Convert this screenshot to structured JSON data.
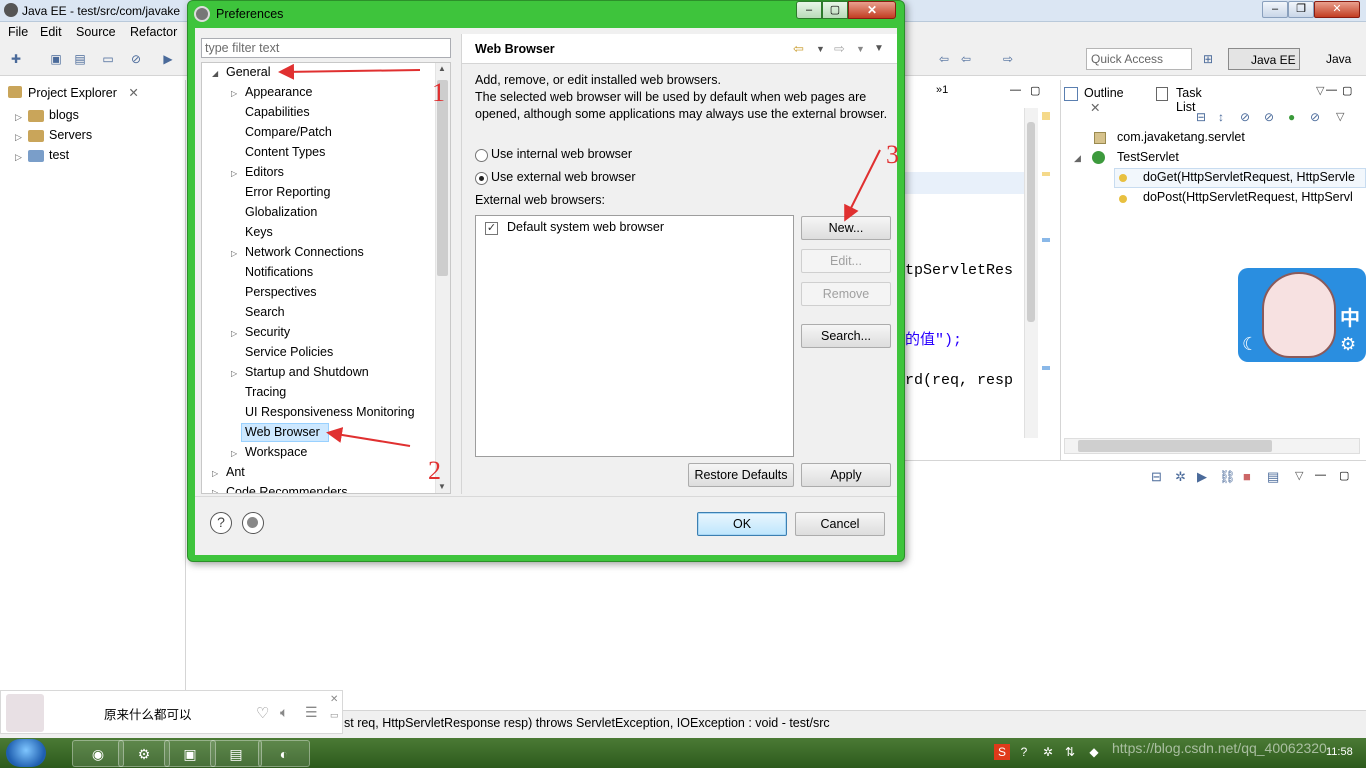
{
  "eclipse": {
    "title": "Java EE - test/src/com/javake",
    "menu": [
      "File",
      "Edit",
      "Source",
      "Refactor"
    ],
    "quick_access": "Quick Access",
    "perspectives": [
      "Java EE",
      "Java"
    ]
  },
  "project_explorer": {
    "tab": "Project Explorer",
    "items": [
      "blogs",
      "Servers",
      "test"
    ]
  },
  "editor": {
    "tab_marker": "»1",
    "lines": [
      "tpServletRes",
      "的值\");",
      "rd(req, resp"
    ]
  },
  "outline": {
    "tabs": [
      "Outline",
      "Task List"
    ],
    "items": [
      "com.javaketang.servlet",
      "TestServlet",
      "doGet(HttpServletRequest, HttpServle",
      "doPost(HttpServletRequest, HttpServl"
    ]
  },
  "status_bar": {
    "text": "st req, HttpServletResponse resp) throws ServletException, IOException : void - test/src"
  },
  "music_popup": {
    "title": "原来什么都可以"
  },
  "taskbar": {
    "clock": "11:58",
    "watermark": "https://blog.csdn.net/qq_40062320"
  },
  "sticker": {
    "char": "中"
  },
  "preferences": {
    "title": "Preferences",
    "filter_placeholder": "type filter text",
    "tree": [
      "General",
      "Appearance",
      "Capabilities",
      "Compare/Patch",
      "Content Types",
      "Editors",
      "Error Reporting",
      "Globalization",
      "Keys",
      "Network Connections",
      "Notifications",
      "Perspectives",
      "Search",
      "Security",
      "Service Policies",
      "Startup and Shutdown",
      "Tracing",
      "UI Responsiveness Monitoring",
      "Web Browser",
      "Workspace",
      "Ant",
      "Code Recommenders"
    ],
    "page": {
      "title": "Web Browser",
      "description": "Add, remove, or edit installed web browsers.\nThe selected web browser will be used by default when web pages are opened, although some applications may always use the external browser.",
      "radio_internal": "Use internal web browser",
      "radio_external": "Use external web browser",
      "external_label": "External web browsers:",
      "browsers": [
        "Default system web browser"
      ],
      "buttons": {
        "new": "New...",
        "edit": "Edit...",
        "remove": "Remove",
        "search": "Search..."
      },
      "restore_defaults": "Restore Defaults",
      "apply": "Apply"
    },
    "ok": "OK",
    "cancel": "Cancel"
  },
  "annotations": [
    "1",
    "2",
    "3"
  ],
  "colors": {
    "dialog_frame": "#3ec43c",
    "annotation": "#e03030",
    "selection": "#cde8ff"
  }
}
